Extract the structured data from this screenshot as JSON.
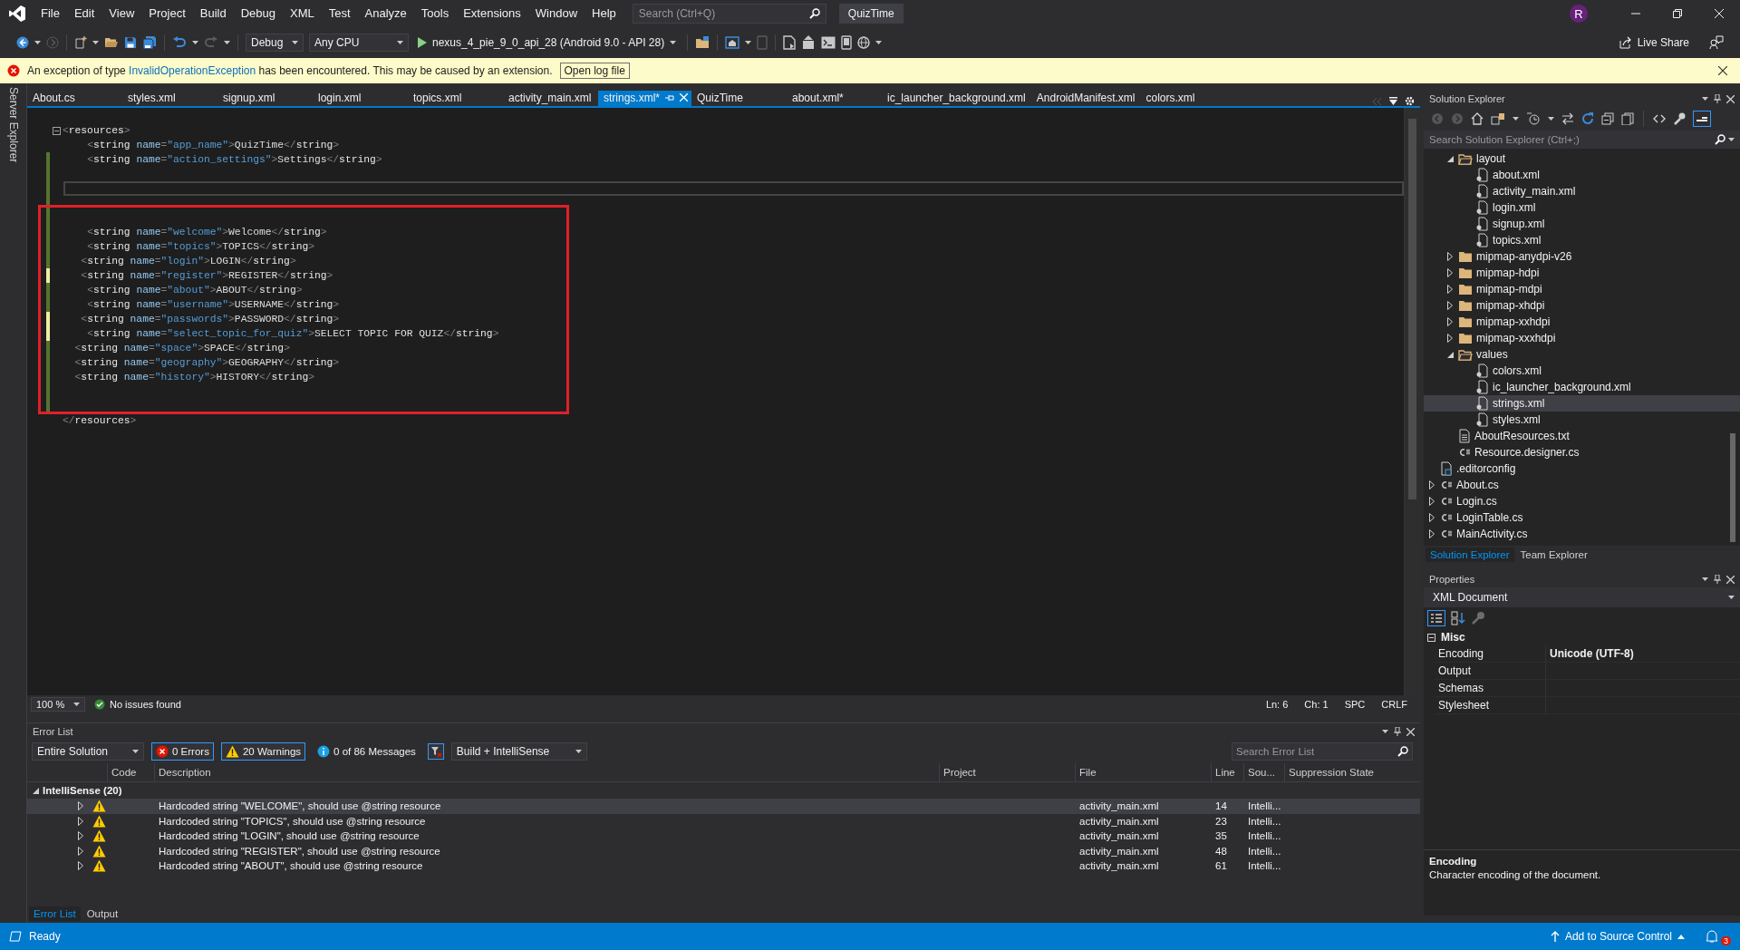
{
  "title_bar": {
    "menu": [
      "File",
      "Edit",
      "View",
      "Project",
      "Build",
      "Debug",
      "XML",
      "Test",
      "Analyze",
      "Tools",
      "Extensions",
      "Window",
      "Help"
    ],
    "search": {
      "placeholder": "Search (Ctrl+Q)"
    },
    "solution_name": "QuizTime",
    "avatar": "R"
  },
  "toolbar": {
    "configuration": "Debug",
    "platform": "Any CPU",
    "run_target": "nexus_4_pie_9_0_api_28 (Android 9.0 - API 28)",
    "live_share": "Live Share"
  },
  "info_bar": {
    "text_before": "An exception of type ",
    "link": "InvalidOperationException",
    "text_after": " has been encountered. This may be caused by an extension.",
    "button": "Open log file"
  },
  "side_strip": {
    "label": "Server Explorer"
  },
  "doc_tabs": [
    {
      "label": "About.cs",
      "selected": false
    },
    {
      "label": "styles.xml",
      "selected": false
    },
    {
      "label": "signup.xml",
      "selected": false
    },
    {
      "label": "login.xml",
      "selected": false
    },
    {
      "label": "topics.xml",
      "selected": false
    },
    {
      "label": "activity_main.xml",
      "selected": false
    },
    {
      "label": "strings.xml*",
      "selected": true
    },
    {
      "label": "QuizTime",
      "selected": false
    },
    {
      "label": "about.xml*",
      "selected": false
    },
    {
      "label": "ic_launcher_background.xml",
      "selected": false
    },
    {
      "label": "AndroidManifest.xml",
      "selected": false
    },
    {
      "label": "colors.xml",
      "selected": false
    }
  ],
  "editor": {
    "lines": [
      {
        "text": "<resources>",
        "foldable": true
      },
      {
        "text": "    <string name=\"app_name\">QuizTime</string>"
      },
      {
        "text": "    <string name=\"action_settings\">Settings</string>",
        "color": "#577430"
      },
      {
        "color": "#577430"
      },
      {
        "color": "#577430",
        "current": true
      },
      {
        "color": "#577430"
      },
      {
        "color": "#577430"
      },
      {
        "text": "    <string name=\"welcome\">Welcome</string>",
        "color": "#577430"
      },
      {
        "text": "    <string name=\"topics\">TOPICS</string>",
        "color": "#577430"
      },
      {
        "text": "   <string name=\"login\">LOGIN</string>",
        "color": "#577430"
      },
      {
        "text": "   <string name=\"register\">REGISTER</string>",
        "color": "#efefa2"
      },
      {
        "text": "    <string name=\"about\">ABOUT</string>",
        "color": "#577430"
      },
      {
        "text": "    <string name=\"username\">USERNAME</string>",
        "color": "#577430"
      },
      {
        "text": "   <string name=\"passwords\">PASSWORD</string>",
        "color": "#efefa2"
      },
      {
        "text": "    <string name=\"select_topic_for_quiz\">SELECT TOPIC FOR QUIZ</string>",
        "color": "#efefa2"
      },
      {
        "text": "  <string name=\"space\">SPACE</string>",
        "color": "#577430"
      },
      {
        "text": "  <string name=\"geography\">GEOGRAPHY</string>",
        "color": "#577430"
      },
      {
        "text": "  <string name=\"history\">HISTORY</string>",
        "color": "#577430"
      },
      {
        "color": "#577430"
      },
      {
        "color": "#577430"
      },
      {
        "text": "</resources>"
      }
    ]
  },
  "editor_status": {
    "zoom": "100 %",
    "issues": "No issues found",
    "line": "Ln: 6",
    "column": "Ch: 1",
    "whitespace": "SPC",
    "line_endings": "CRLF"
  },
  "error_list": {
    "title": "Error List",
    "scope": "Entire Solution",
    "filters": [
      {
        "kind": "error",
        "label": "0 Errors",
        "selected": true
      },
      {
        "kind": "warning",
        "label": "20 Warnings",
        "selected": true
      },
      {
        "kind": "message",
        "label": "0 of 86 Messages",
        "selected": false
      }
    ],
    "source_filter": "Build + IntelliSense",
    "search": {
      "placeholder": "Search Error List"
    },
    "columns": [
      "Code",
      "Description",
      "Project",
      "File",
      "Line",
      "Sou...",
      "Suppression State"
    ],
    "group": {
      "label": "IntelliSense (20)",
      "expanded": true
    },
    "rows": [
      {
        "description": "Hardcoded string \"WELCOME\", should use @string resource",
        "file": "activity_main.xml",
        "line": "14",
        "source": "Intelli...",
        "selected": true
      },
      {
        "description": "Hardcoded string \"TOPICS\", should use @string resource",
        "file": "activity_main.xml",
        "line": "23",
        "source": "Intelli...",
        "selected": false
      },
      {
        "description": "Hardcoded string \"LOGIN\", should use @string resource",
        "file": "activity_main.xml",
        "line": "35",
        "source": "Intelli...",
        "selected": false
      },
      {
        "description": "Hardcoded string \"REGISTER\", should use @string resource",
        "file": "activity_main.xml",
        "line": "48",
        "source": "Intelli...",
        "selected": false
      },
      {
        "description": "Hardcoded string \"ABOUT\", should use @string resource",
        "file": "activity_main.xml",
        "line": "61",
        "source": "Intelli...",
        "selected": false
      }
    ],
    "tabs": [
      {
        "label": "Error List",
        "selected": true
      },
      {
        "label": "Output",
        "selected": false
      }
    ]
  },
  "solution_explorer": {
    "title": "Solution Explorer",
    "search": {
      "placeholder": "Search Solution Explorer (Ctrl+;)"
    },
    "tree": [
      {
        "children": [
          {
            "label": "layout",
            "kind": "folder",
            "expanded": true,
            "selected": false,
            "children": [
              {
                "label": "about.xml",
                "kind": "xml",
                "selected": false
              },
              {
                "label": "activity_main.xml",
                "kind": "xml",
                "selected": false
              },
              {
                "label": "login.xml",
                "kind": "xml",
                "selected": false
              },
              {
                "label": "signup.xml",
                "kind": "xml",
                "selected": false
              },
              {
                "label": "topics.xml",
                "kind": "xml",
                "selected": false
              }
            ]
          },
          {
            "label": "mipmap-anydpi-v26",
            "kind": "folder",
            "expanded": false,
            "selected": false
          },
          {
            "label": "mipmap-hdpi",
            "kind": "folder",
            "expanded": false,
            "selected": false
          },
          {
            "label": "mipmap-mdpi",
            "kind": "folder",
            "expanded": false,
            "selected": false
          },
          {
            "label": "mipmap-xhdpi",
            "kind": "folder",
            "expanded": false,
            "selected": false
          },
          {
            "label": "mipmap-xxhdpi",
            "kind": "folder",
            "expanded": false,
            "selected": false
          },
          {
            "label": "mipmap-xxxhdpi",
            "kind": "folder",
            "expanded": false,
            "selected": false
          },
          {
            "label": "values",
            "kind": "folder",
            "expanded": true,
            "selected": false,
            "children": [
              {
                "label": "colors.xml",
                "kind": "xml",
                "selected": false
              },
              {
                "label": "ic_launcher_background.xml",
                "kind": "xml",
                "selected": false
              },
              {
                "label": "strings.xml",
                "kind": "xml",
                "selected": true
              },
              {
                "label": "styles.xml",
                "kind": "xml",
                "selected": false
              }
            ]
          },
          {
            "label": "AboutResources.txt",
            "kind": "text",
            "selected": false
          },
          {
            "label": "Resource.designer.cs",
            "kind": "cs",
            "selected": false
          }
        ]
      },
      {
        "label": ".editorconfig",
        "kind": "config",
        "selected": false
      },
      {
        "label": "About.cs",
        "kind": "cs",
        "expanded": false,
        "selected": false
      },
      {
        "label": "Login.cs",
        "kind": "cs",
        "expanded": false,
        "selected": false
      },
      {
        "label": "LoginTable.cs",
        "kind": "cs",
        "expanded": false,
        "selected": false
      },
      {
        "label": "MainActivity.cs",
        "kind": "cs",
        "expanded": false,
        "selected": false
      }
    ],
    "tabs": [
      {
        "label": "Solution Explorer",
        "selected": true
      },
      {
        "label": "Team Explorer",
        "selected": false
      }
    ]
  },
  "properties": {
    "title": "Properties",
    "object": "XML Document",
    "group": {
      "label": "Misc",
      "expanded": true
    },
    "rows": [
      {
        "name": "Encoding",
        "value": "Unicode (UTF-8)"
      },
      {
        "name": "Output"
      },
      {
        "name": "Schemas"
      },
      {
        "name": "Stylesheet"
      }
    ],
    "description": {
      "title": "Encoding",
      "text": "Character encoding of the document."
    }
  },
  "status_bar": {
    "text": "Ready",
    "source_control": "Add to Source Control",
    "notifications": "3"
  }
}
